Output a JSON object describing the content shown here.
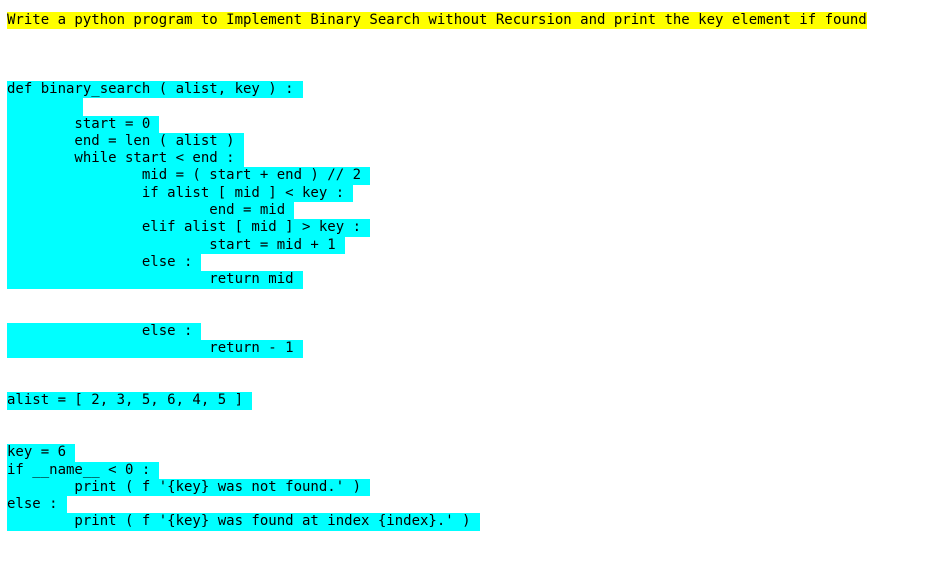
{
  "title": "Write a python program to Implement Binary Search without Recursion and print the key element if found",
  "highlight_colors": {
    "title": "#ffff00",
    "code": "#00ffff"
  },
  "code_lines": [
    "def binary_search ( alist, key ) :",
    "        ",
    "        start = 0",
    "        end = len ( alist )",
    "        while start < end :",
    "                mid = ( start + end ) // 2",
    "                if alist [ mid ] < key :",
    "                        end = mid",
    "                elif alist [ mid ] > key :",
    "                        start = mid + 1",
    "                else :",
    "                        return mid",
    "",
    "",
    "                else :",
    "                        return - 1",
    "",
    "",
    "alist = [ 2, 3, 5, 6, 4, 5 ]",
    "",
    "",
    "key = 6",
    "if __name__ < 0 :",
    "        print ( f '{key} was not found.' )",
    "else :",
    "        print ( f '{key} was found at index {index}.' )"
  ]
}
